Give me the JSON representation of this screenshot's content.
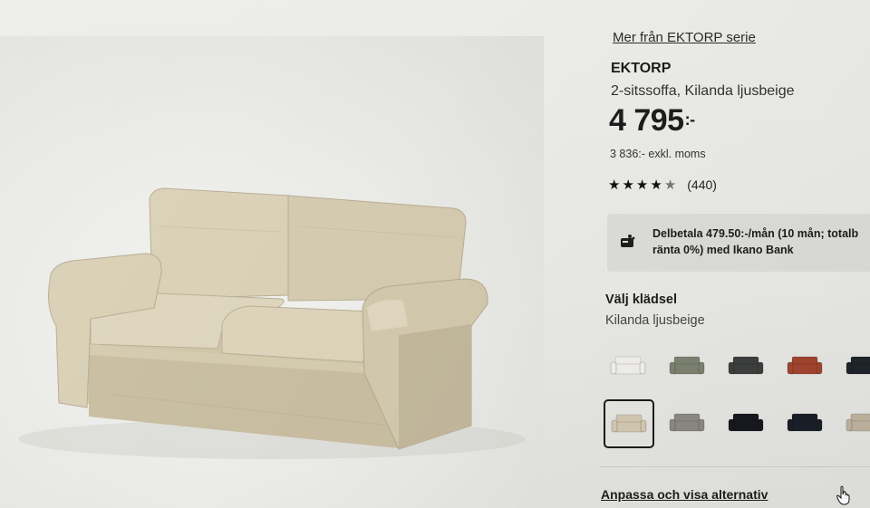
{
  "product": {
    "series_link": "Mer från EKTORP serie",
    "name": "EKTORP",
    "description": "2-sitssoffa, Kilanda ljusbeige",
    "price": "4 795",
    "price_suffix": ":-",
    "price_ex_vat": "3 836:- exkl. moms",
    "rating_stars": 4.5,
    "rating_max": 5,
    "review_count": "(440)"
  },
  "finance": {
    "line1": "Delbetala 479.50:-/mån (10 mån; totalb",
    "line2": "ränta 0%) med Ikano Bank",
    "icon": "payment-icon"
  },
  "upholstery": {
    "label": "Välj klädsel",
    "selected": "Kilanda ljusbeige",
    "swatches": [
      {
        "color": "#f0efec"
      },
      {
        "color": "#7d8270"
      },
      {
        "color": "#3c3f3e"
      },
      {
        "color": "#a2452f"
      },
      {
        "color": "#20242b"
      },
      {
        "color": "#d3c8b0",
        "selected": true
      },
      {
        "color": "#8a8984"
      },
      {
        "color": "#16191f"
      },
      {
        "color": "#1b1f27"
      },
      {
        "color": "#bdb39e"
      }
    ]
  },
  "actions": {
    "customize_link": "Anpassa och visa alternativ"
  },
  "colors": {
    "sofa": "#d6cdb3",
    "sofa_shadow": "#bfb396",
    "text": "#1d1d1d"
  }
}
